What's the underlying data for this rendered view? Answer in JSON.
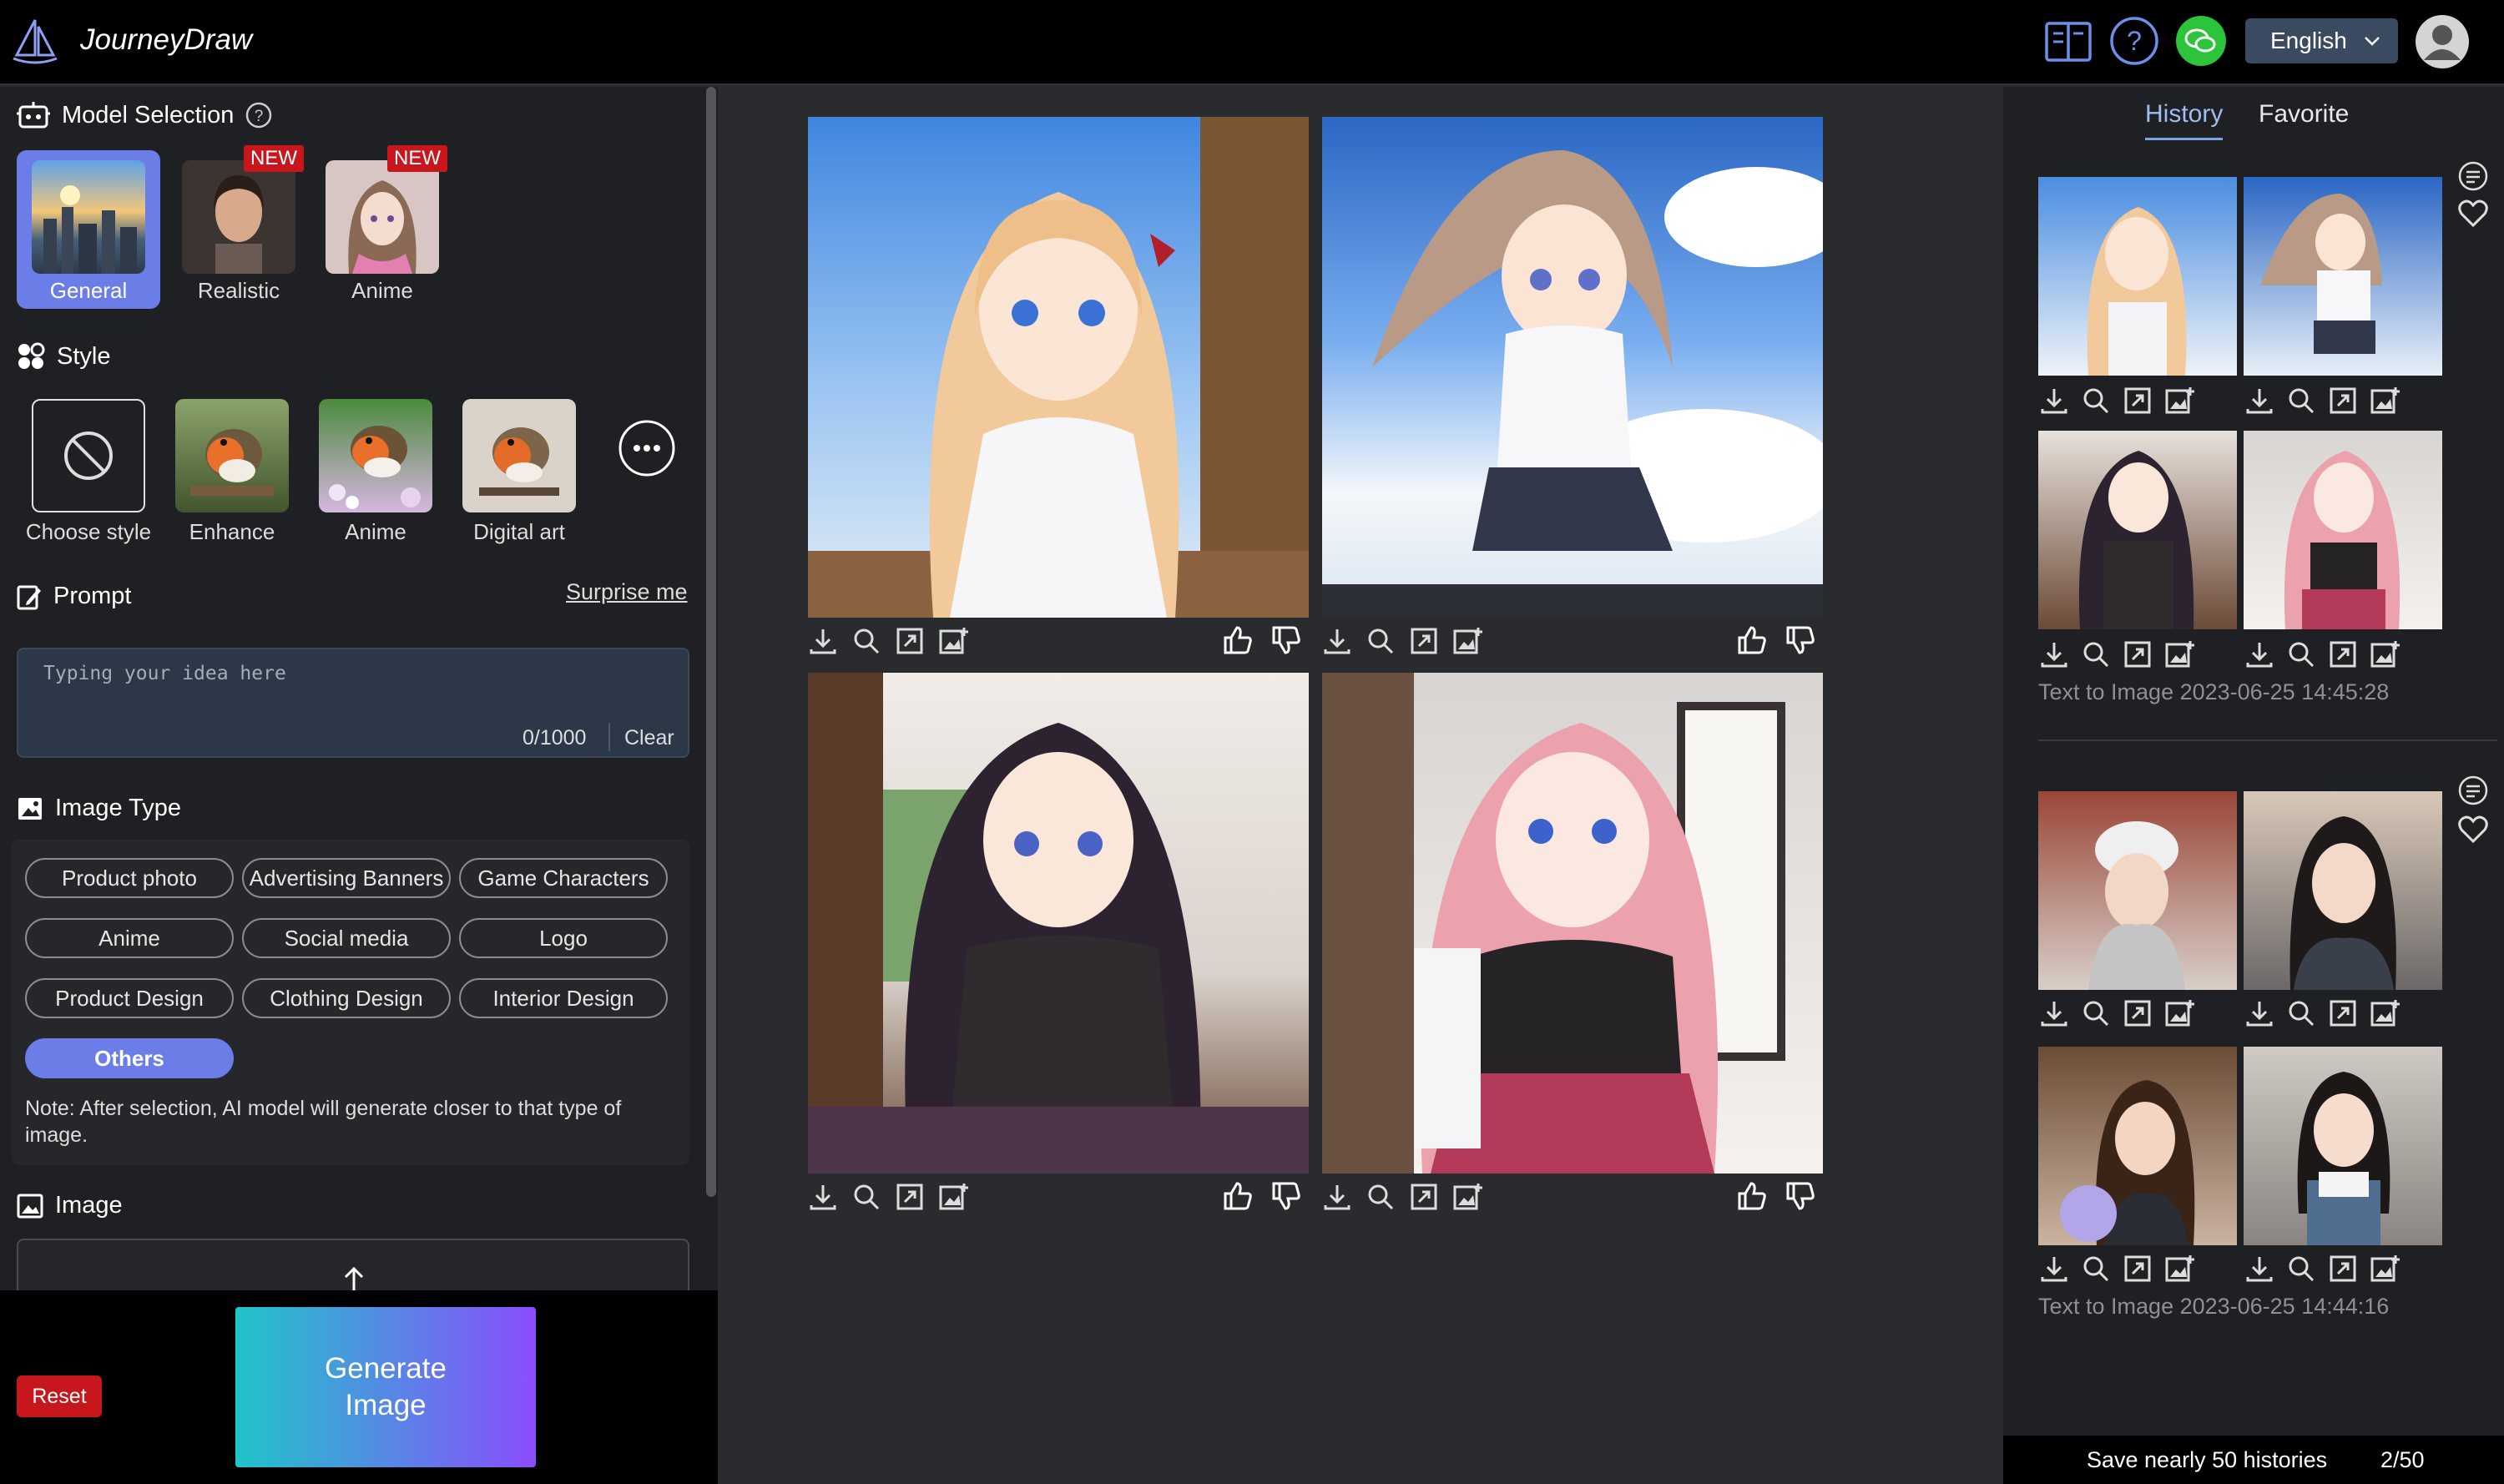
{
  "app": {
    "title": "JourneyDraw"
  },
  "topbar": {
    "language": "English"
  },
  "sidebar": {
    "model_selection_title": "Model Selection",
    "models": [
      {
        "label": "General",
        "selected": true
      },
      {
        "label": "Realistic",
        "badge": "NEW"
      },
      {
        "label": "Anime",
        "badge": "NEW"
      }
    ],
    "style_title": "Style",
    "styles": [
      {
        "label": "Choose style"
      },
      {
        "label": "Enhance"
      },
      {
        "label": "Anime"
      },
      {
        "label": "Digital art"
      }
    ],
    "prompt_title": "Prompt",
    "surprise_label": "Surprise me",
    "prompt_placeholder": "Typing your idea here",
    "prompt_count": "0/1000",
    "clear_label": "Clear",
    "image_type_title": "Image Type",
    "image_types": [
      "Product photo",
      "Advertising Banners",
      "Game Characters",
      "Anime",
      "Social media",
      "Logo",
      "Product Design",
      "Clothing Design",
      "Interior Design",
      "Others"
    ],
    "selected_image_type": "Others",
    "note": "Note: After selection, AI model will generate closer to that type of image.",
    "image_title": "Image",
    "reset_label": "Reset",
    "generate_label": "Generate Image"
  },
  "history": {
    "tabs": [
      "History",
      "Favorite"
    ],
    "groups": [
      {
        "caption": "Text to Image 2023-06-25 14:45:28"
      },
      {
        "caption": "Text to Image 2023-06-25 14:44:16"
      }
    ],
    "footer_text": "Save nearly 50 histories",
    "footer_count": "2/50"
  },
  "colors": {
    "accent": "#6b7de6",
    "danger": "#c8161d",
    "wechat": "#2bc43a"
  }
}
